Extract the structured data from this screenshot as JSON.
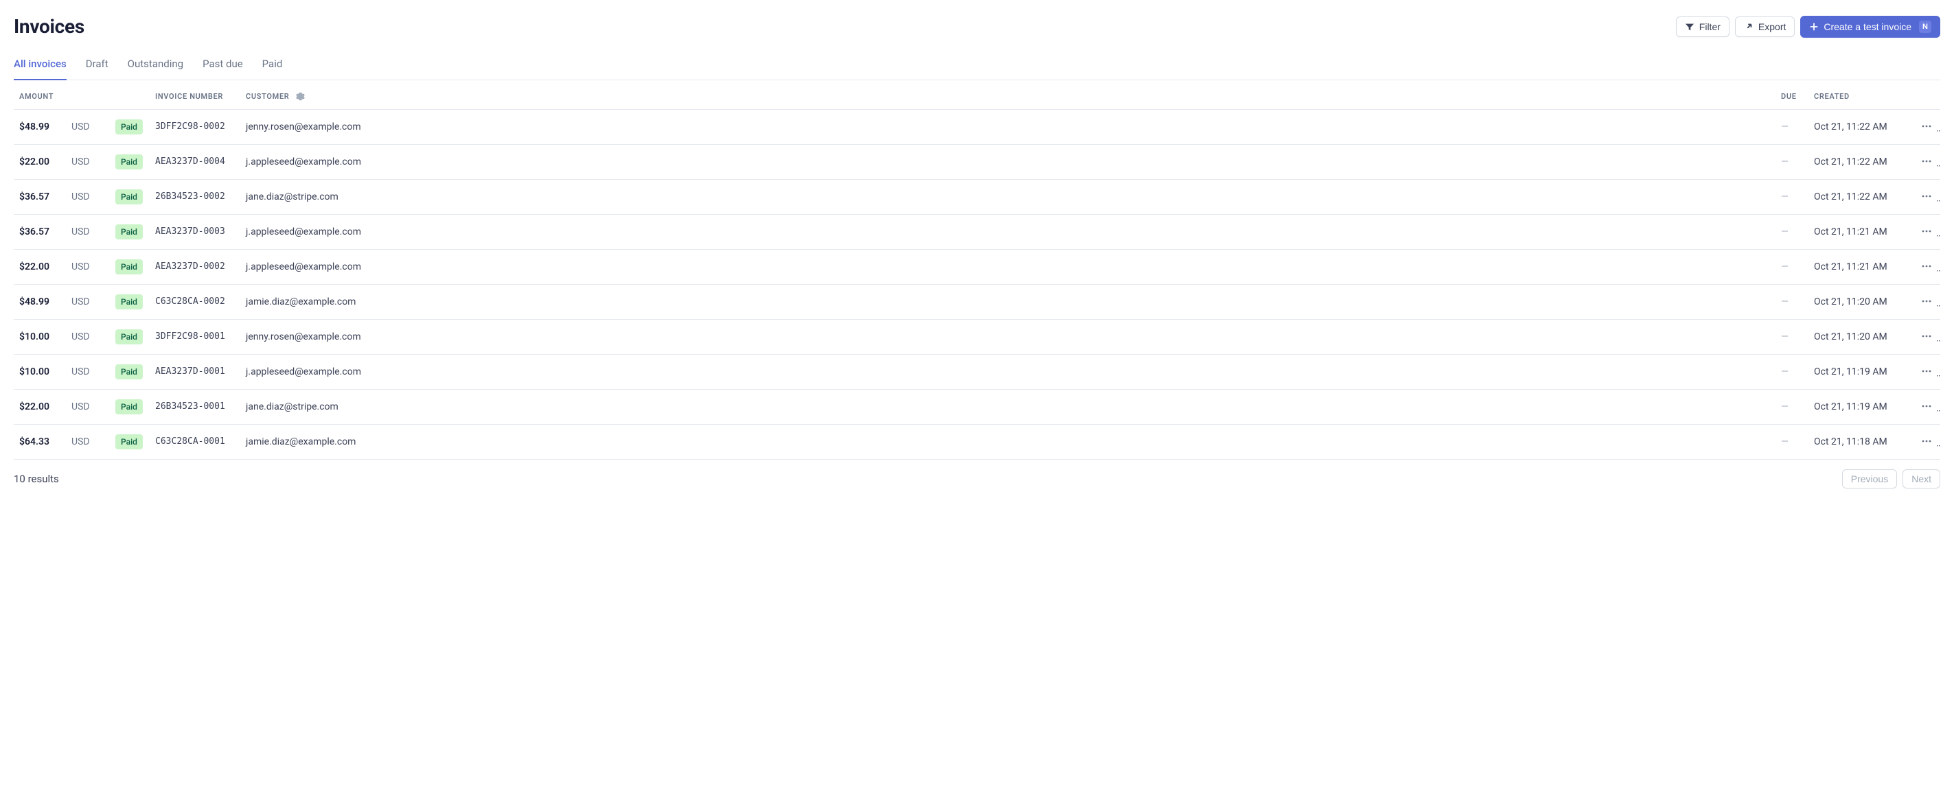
{
  "header": {
    "title": "Invoices",
    "filter_label": "Filter",
    "export_label": "Export",
    "create_label": "Create a test invoice",
    "create_kbd": "N"
  },
  "tabs": [
    {
      "label": "All invoices",
      "active": true
    },
    {
      "label": "Draft",
      "active": false
    },
    {
      "label": "Outstanding",
      "active": false
    },
    {
      "label": "Past due",
      "active": false
    },
    {
      "label": "Paid",
      "active": false
    }
  ],
  "columns": {
    "amount": "Amount",
    "invoice_number": "Invoice Number",
    "customer": "Customer",
    "due": "Due",
    "created": "Created"
  },
  "rows": [
    {
      "amount": "$48.99",
      "currency": "USD",
      "status": "Paid",
      "invoice_number": "3DFF2C98-0002",
      "customer": "jenny.rosen@example.com",
      "due": "—",
      "created": "Oct 21, 11:22 AM"
    },
    {
      "amount": "$22.00",
      "currency": "USD",
      "status": "Paid",
      "invoice_number": "AEA3237D-0004",
      "customer": "j.appleseed@example.com",
      "due": "—",
      "created": "Oct 21, 11:22 AM"
    },
    {
      "amount": "$36.57",
      "currency": "USD",
      "status": "Paid",
      "invoice_number": "26B34523-0002",
      "customer": "jane.diaz@stripe.com",
      "due": "—",
      "created": "Oct 21, 11:22 AM"
    },
    {
      "amount": "$36.57",
      "currency": "USD",
      "status": "Paid",
      "invoice_number": "AEA3237D-0003",
      "customer": "j.appleseed@example.com",
      "due": "—",
      "created": "Oct 21, 11:21 AM"
    },
    {
      "amount": "$22.00",
      "currency": "USD",
      "status": "Paid",
      "invoice_number": "AEA3237D-0002",
      "customer": "j.appleseed@example.com",
      "due": "—",
      "created": "Oct 21, 11:21 AM"
    },
    {
      "amount": "$48.99",
      "currency": "USD",
      "status": "Paid",
      "invoice_number": "C63C28CA-0002",
      "customer": "jamie.diaz@example.com",
      "due": "—",
      "created": "Oct 21, 11:20 AM"
    },
    {
      "amount": "$10.00",
      "currency": "USD",
      "status": "Paid",
      "invoice_number": "3DFF2C98-0001",
      "customer": "jenny.rosen@example.com",
      "due": "—",
      "created": "Oct 21, 11:20 AM"
    },
    {
      "amount": "$10.00",
      "currency": "USD",
      "status": "Paid",
      "invoice_number": "AEA3237D-0001",
      "customer": "j.appleseed@example.com",
      "due": "—",
      "created": "Oct 21, 11:19 AM"
    },
    {
      "amount": "$22.00",
      "currency": "USD",
      "status": "Paid",
      "invoice_number": "26B34523-0001",
      "customer": "jane.diaz@stripe.com",
      "due": "—",
      "created": "Oct 21, 11:19 AM"
    },
    {
      "amount": "$64.33",
      "currency": "USD",
      "status": "Paid",
      "invoice_number": "C63C28CA-0001",
      "customer": "jamie.diaz@example.com",
      "due": "—",
      "created": "Oct 21, 11:18 AM"
    }
  ],
  "footer": {
    "results": "10 results",
    "previous": "Previous",
    "next": "Next"
  },
  "colors": {
    "accent": "#5469d4",
    "status_paid_bg": "#cbf4c9",
    "status_paid_text": "#0e6245"
  }
}
